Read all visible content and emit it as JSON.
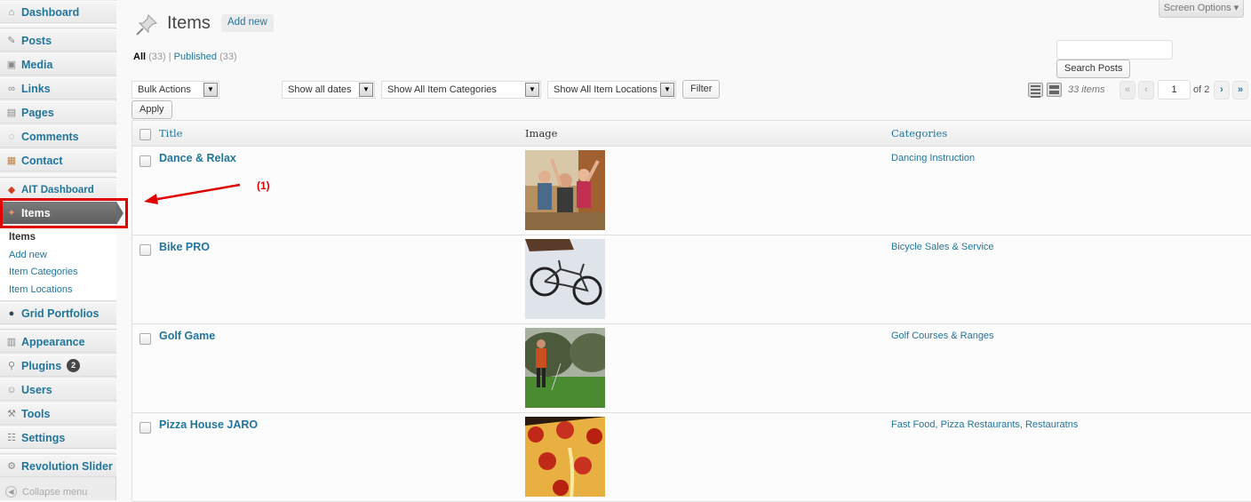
{
  "sidebar": {
    "items": [
      {
        "label": "Dashboard",
        "icon": "dashboard-icon"
      },
      {
        "label": "Posts",
        "icon": "pin-icon"
      },
      {
        "label": "Media",
        "icon": "media-icon"
      },
      {
        "label": "Links",
        "icon": "link-icon"
      },
      {
        "label": "Pages",
        "icon": "pages-icon"
      },
      {
        "label": "Comments",
        "icon": "comment-icon"
      },
      {
        "label": "Contact",
        "icon": "contact-icon"
      },
      {
        "label": "AIT Dashboard",
        "icon": "ait-icon"
      },
      {
        "label": "Items",
        "icon": "items-icon"
      },
      {
        "label": "Grid Portfolios",
        "icon": "portfolio-icon"
      },
      {
        "label": "Appearance",
        "icon": "appearance-icon"
      },
      {
        "label": "Plugins",
        "icon": "plugin-icon",
        "badge": "2"
      },
      {
        "label": "Users",
        "icon": "users-icon"
      },
      {
        "label": "Tools",
        "icon": "tools-icon"
      },
      {
        "label": "Settings",
        "icon": "settings-icon"
      },
      {
        "label": "Revolution Slider",
        "icon": "gear-icon"
      }
    ],
    "submenu": [
      "Items",
      "Add new",
      "Item Categories",
      "Item Locations"
    ],
    "collapse_label": "Collapse menu"
  },
  "header": {
    "title": "Items",
    "add_new": "Add new",
    "screen_options": "Screen Options"
  },
  "filters": {
    "all_label": "All",
    "all_count": "(33)",
    "separator": "|",
    "published_label": "Published",
    "published_count": "(33)"
  },
  "search": {
    "button": "Search Posts",
    "value": ""
  },
  "toolbar": {
    "bulk_actions": "Bulk Actions",
    "apply": "Apply",
    "dates": "Show all dates",
    "categories": "Show All Item Categories",
    "locations": "Show All Item Locations",
    "filter": "Filter"
  },
  "pagination": {
    "count": "33 items",
    "first": "«",
    "prev": "‹",
    "current": "1",
    "of": "of 2",
    "next": "›",
    "last": "»"
  },
  "table": {
    "columns": [
      "Title",
      "Image",
      "Categories"
    ],
    "rows": [
      {
        "title": "Dance & Relax",
        "category": "Dancing Instruction",
        "image": "dancers-photo"
      },
      {
        "title": "Bike PRO",
        "category": "Bicycle Sales & Service",
        "image": "bicycle-photo"
      },
      {
        "title": "Golf Game",
        "category": "Golf Courses & Ranges",
        "image": "golfer-photo"
      },
      {
        "title": "Pizza House JARO",
        "category": "Fast Food, Pizza Restaurants, Restauratns",
        "image": "pizza-photo"
      }
    ]
  },
  "annotation": {
    "label": "(1)",
    "color": "#e00000"
  },
  "colors": {
    "link": "#21759b",
    "highlight": "#e00000"
  }
}
